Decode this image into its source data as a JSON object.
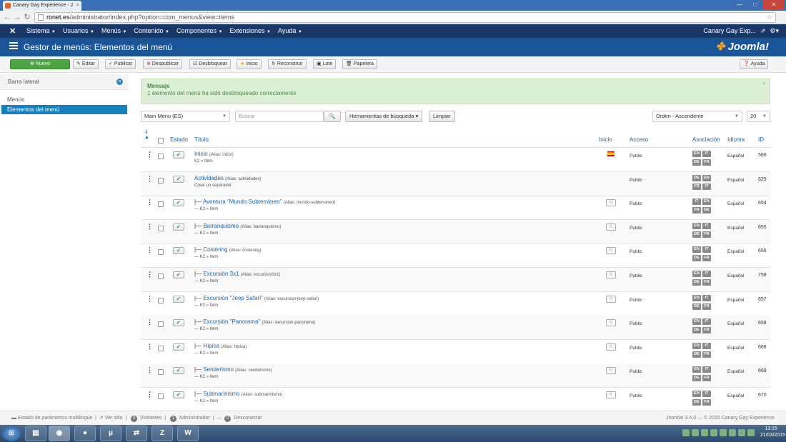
{
  "browser": {
    "tab_title": "Canary Gay Experience - J",
    "url_host": "ronet.es",
    "url_path": "/administrator/index.php?option=com_menus&view=items",
    "win_min": "—",
    "win_max": "□",
    "win_close": "✕"
  },
  "menubar": {
    "items": [
      {
        "label": "Sistema"
      },
      {
        "label": "Usuarios"
      },
      {
        "label": "Menús"
      },
      {
        "label": "Contenido"
      },
      {
        "label": "Componentes"
      },
      {
        "label": "Extensiones"
      },
      {
        "label": "Ayuda"
      }
    ],
    "site_name": "Canary Gay Exp...",
    "settings_icon": "gear-icon"
  },
  "title_bar": {
    "title": "Gestor de menús: Elementos del menú",
    "logo_text": "Joomla!"
  },
  "toolbar": {
    "new": "Nuevo",
    "edit": "Editar",
    "publish": "Publicar",
    "unpublish": "Despublicar",
    "unlock": "Desbloquear",
    "home": "Inicio",
    "rebuild": "Reconstruir",
    "batch": "Lote",
    "trash": "Papelera",
    "help": "Ayuda"
  },
  "sidebar": {
    "title": "Barra lateral",
    "items": [
      {
        "label": "Menús"
      },
      {
        "label": "Elementos del menú"
      }
    ]
  },
  "message": {
    "heading": "Mensaje",
    "text": "1 elemento del menú ha sido desbloqueado correctamente"
  },
  "filters": {
    "menu_select": "Main Menu (ES)",
    "search_placeholder": "Buscar",
    "search_tools": "Herramientas de búsqueda",
    "clear": "Limpiar",
    "ordering": "Orden - Ascendente",
    "limit": "20"
  },
  "table": {
    "headers": {
      "status": "Estado",
      "title": "Título",
      "home": "Inicio",
      "access": "Acceso",
      "association": "Asociación",
      "language": "Idioma",
      "id": "ID"
    },
    "rows": [
      {
        "title": "Inicio",
        "prefix": "",
        "alias": "(Alias: inicio)",
        "sub": "K2 » Item",
        "home": "flag",
        "access": "Public",
        "assoc": [
          "EN",
          "IT",
          "DE",
          "FR"
        ],
        "language": "Español",
        "id": "566"
      },
      {
        "title": "Actividades",
        "prefix": "",
        "alias": "(Alias: actividades)",
        "sub": "Crear un separador",
        "home": "none",
        "access": "Public",
        "assoc": [
          "DE",
          "EN",
          "FR",
          "IT"
        ],
        "language": "Español",
        "id": "625"
      },
      {
        "title": "Aventura \"Mundo Subterráneo\"",
        "prefix": "|— ",
        "alias": "(Alias: mundo-subterraneo)",
        "sub": "— K2 » Item",
        "home": "star",
        "access": "Public",
        "assoc": [
          "IT",
          "EN",
          "FR",
          "DE"
        ],
        "language": "Español",
        "id": "654"
      },
      {
        "title": "Barranquismo",
        "prefix": "|— ",
        "alias": "(Alias: barranquismo)",
        "sub": "— K2 » Item",
        "home": "star",
        "access": "Public",
        "assoc": [
          "EN",
          "IT",
          "DE",
          "FR"
        ],
        "language": "Español",
        "id": "655"
      },
      {
        "title": "Costering",
        "prefix": "|— ",
        "alias": "(Alias: costering)",
        "sub": "— K2 » Item",
        "home": "star",
        "access": "Public",
        "assoc": [
          "EN",
          "IT",
          "DE",
          "FR"
        ],
        "language": "Español",
        "id": "656"
      },
      {
        "title": "Excursión 3x1",
        "prefix": "|— ",
        "alias": "(Alias: excursion3x1)",
        "sub": "— K2 » Item",
        "home": "star",
        "access": "Public",
        "assoc": [
          "EN",
          "IT",
          "DE",
          "FR"
        ],
        "language": "Español",
        "id": "758"
      },
      {
        "title": "Excursión \"Jeep Safari\"",
        "prefix": "|— ",
        "alias": "(Alias: excursion-jeep-safari)",
        "sub": "— K2 » Item",
        "home": "star",
        "access": "Public",
        "assoc": [
          "EN",
          "IT",
          "DE",
          "FR"
        ],
        "language": "Español",
        "id": "657"
      },
      {
        "title": "Excursión \"Panorama\"",
        "prefix": "|— ",
        "alias": "(Alias: excursion-panorama)",
        "sub": "— K2 » Item",
        "home": "star",
        "access": "Public",
        "assoc": [
          "EN",
          "IT",
          "DE",
          "FR"
        ],
        "language": "Español",
        "id": "658"
      },
      {
        "title": "Hípica",
        "prefix": "|— ",
        "alias": "(Alias: hipica)",
        "sub": "— K2 » Item",
        "home": "star",
        "access": "Public",
        "assoc": [
          "EN",
          "IT",
          "DE",
          "FR"
        ],
        "language": "Español",
        "id": "668"
      },
      {
        "title": "Senderismo",
        "prefix": "|— ",
        "alias": "(Alias: senderismo)",
        "sub": "— K2 » Item",
        "home": "star",
        "access": "Public",
        "assoc": [
          "EN",
          "IT",
          "DE",
          "FR"
        ],
        "language": "Español",
        "id": "669"
      },
      {
        "title": "Submarinismo",
        "prefix": "|— ",
        "alias": "(Alias: submarinismo)",
        "sub": "— K2 » Item",
        "home": "star",
        "access": "Public",
        "assoc": [
          "EN",
          "IT",
          "DE",
          "FR"
        ],
        "language": "Español",
        "id": "670"
      }
    ]
  },
  "footer": {
    "multilang": "Estado de parámetros multilingüe",
    "view_site": "Ver sitio",
    "visitors_count": "0",
    "visitors": "Visitantes",
    "admin_count": "1",
    "admin": "Administrador",
    "logout_count": "0",
    "logout": "Desconectar",
    "copyright": "Joomla! 3.4.0 — © 2015 Canary Gay Experience"
  },
  "taskbar": {
    "time": "13:15",
    "date": "21/03/2015"
  },
  "colors": {
    "menubar": "#1a3867",
    "titlebar": "#1a5598",
    "new_button": "#4ba540",
    "active_sidebar": "#1680bf",
    "message_bg": "#dff0d8",
    "link": "#1a63a3"
  }
}
